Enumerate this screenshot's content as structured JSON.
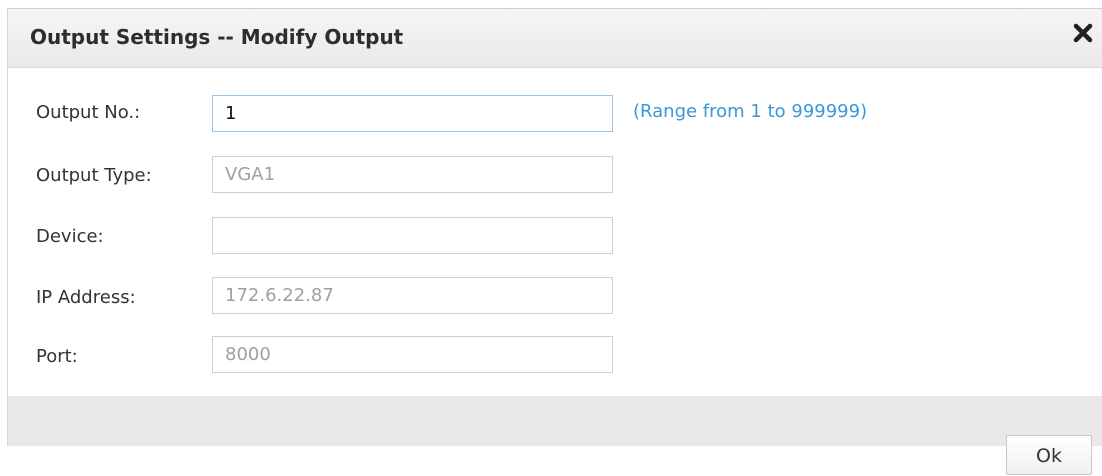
{
  "dialog": {
    "title": "Output Settings -- Modify Output",
    "close_icon": "close-x-icon"
  },
  "form": {
    "output_no": {
      "label": "Output No.:",
      "value": "1",
      "hint": "(Range from 1 to 999999)"
    },
    "output_type": {
      "label": "Output Type:",
      "value": "VGA1"
    },
    "device": {
      "label": "Device:",
      "value": ""
    },
    "ip_address": {
      "label": "IP Address:",
      "value": "172.6.22.87"
    },
    "port": {
      "label": "Port:",
      "value": "8000"
    }
  },
  "footer": {
    "ok_label": "Ok"
  },
  "colors": {
    "hint": "#3a97d8",
    "titlebar": "#ececec",
    "footer": "#e8e8e8"
  }
}
